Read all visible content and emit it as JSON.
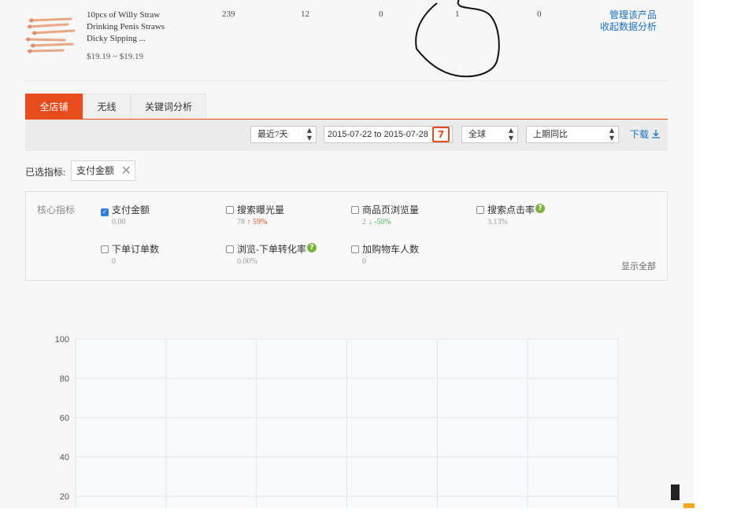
{
  "product": {
    "title_line1": "10pcs of Willy Straw",
    "title_line2": "Drinking Penis Straws",
    "title_line3": "Dicky Sipping ...",
    "price": "$19.19 ~ $19.19",
    "stats": [
      "239",
      "12",
      "0",
      "1",
      "0"
    ],
    "manage_link": "管理该产品",
    "collect_link": "收起数据分析"
  },
  "tabs": [
    "全店铺",
    "无线",
    "关键词分析"
  ],
  "filters": {
    "period": "最近7天",
    "date_range": "2015-07-22 to 2015-07-28",
    "calendar_glyph": "7",
    "region": "全球",
    "compare": "上期同比",
    "download": "下载"
  },
  "selected": {
    "label": "已选指标:",
    "chip": "支付金额"
  },
  "metrics": {
    "title": "核心指标",
    "items": [
      {
        "label": "支付金额",
        "value": "0.00"
      },
      {
        "label": "搜索曝光量",
        "value": "78",
        "change": "59%"
      },
      {
        "label": "商品页浏览量",
        "value": "2",
        "change": "-50%"
      },
      {
        "label": "搜索点击率",
        "value": "3.13%"
      },
      {
        "label": "下单订单数",
        "value": "0"
      },
      {
        "label": "浏览-下单转化率",
        "value": "0.00%"
      },
      {
        "label": "加购物车人数",
        "value": "0"
      }
    ],
    "help_glyph": "?",
    "up_arrow": "↑",
    "down_arrow": "↓",
    "show_all": "显示全部"
  },
  "chart_data": {
    "type": "line",
    "y_ticks": [
      "100",
      "80",
      "60",
      "40",
      "20"
    ],
    "ylim": [
      0,
      100
    ],
    "grid": true,
    "series": []
  },
  "colors": {
    "accent": "#e84b1b",
    "link": "#1a6fc4",
    "up": "#e84b1b",
    "down": "#4caf50"
  }
}
